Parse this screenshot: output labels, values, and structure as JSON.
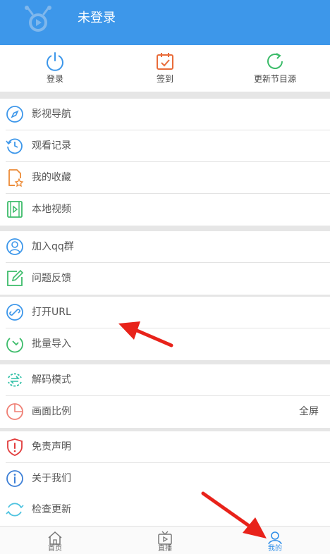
{
  "header": {
    "title": "未登录"
  },
  "quick_actions": [
    {
      "label": "登录",
      "icon": "power-icon"
    },
    {
      "label": "签到",
      "icon": "calendar-check-icon"
    },
    {
      "label": "更新节目源",
      "icon": "refresh-icon"
    }
  ],
  "menu": {
    "nav": "影视导航",
    "history": "观看记录",
    "favorites": "我的收藏",
    "local_video": "本地视频",
    "join_qq": "加入qq群",
    "feedback": "问题反馈",
    "open_url": "打开URL",
    "batch_import": "批量导入",
    "decode_mode": "解码模式",
    "aspect_ratio": "画面比例",
    "aspect_ratio_value": "全屏",
    "disclaimer": "免责声明",
    "about": "关于我们",
    "check_update": "检查更新"
  },
  "tabbar": {
    "home": "首页",
    "live": "直播",
    "mine": "我的"
  },
  "colors": {
    "header_bg": "#3d97ea",
    "active_tab": "#2f8ee8",
    "annotation_arrow": "#e8221a"
  }
}
